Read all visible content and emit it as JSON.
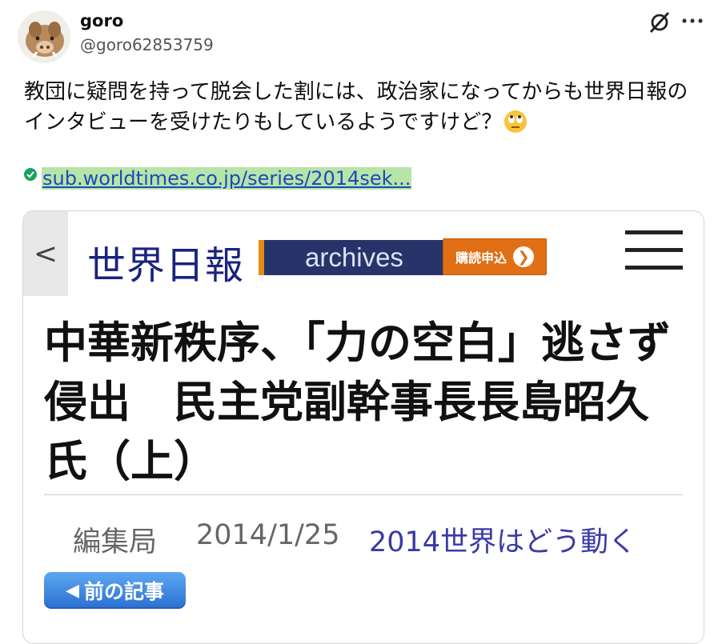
{
  "post": {
    "display_name": "goro",
    "handle": "@goro62853759",
    "text": "教団に疑問を持って脱会した割には、政治家になってからも世界日報のインタビューを受けたりもしているようですけど？",
    "link": "sub.worldtimes.co.jp/series/2014sek..."
  },
  "icons": {
    "avatar": "boar-avatar",
    "hide": "hide-icon",
    "more": "more-icon",
    "emoji": "rolling-eyes-emoji",
    "verified": "green-check-icon"
  },
  "embed": {
    "back_label": "<",
    "site_name": "世界日報",
    "archives_label": "archives",
    "subscribe_label": "購読申込",
    "subscribe_arrow": "❯",
    "title": "中華新秩序、「力の空白」逃さず侵出　民主党副幹事長長島昭久氏（上）",
    "author": "編集局",
    "date": "2014/1/25",
    "series": "2014世界はどう動く",
    "prev_article_label": "前の記事",
    "prev_arrow": "◀"
  },
  "colors": {
    "link_highlight": "#b7e4a7",
    "site_navy": "#1a237e",
    "subscribe_orange": "#e06f15",
    "series_blue": "#3a3aa6"
  }
}
